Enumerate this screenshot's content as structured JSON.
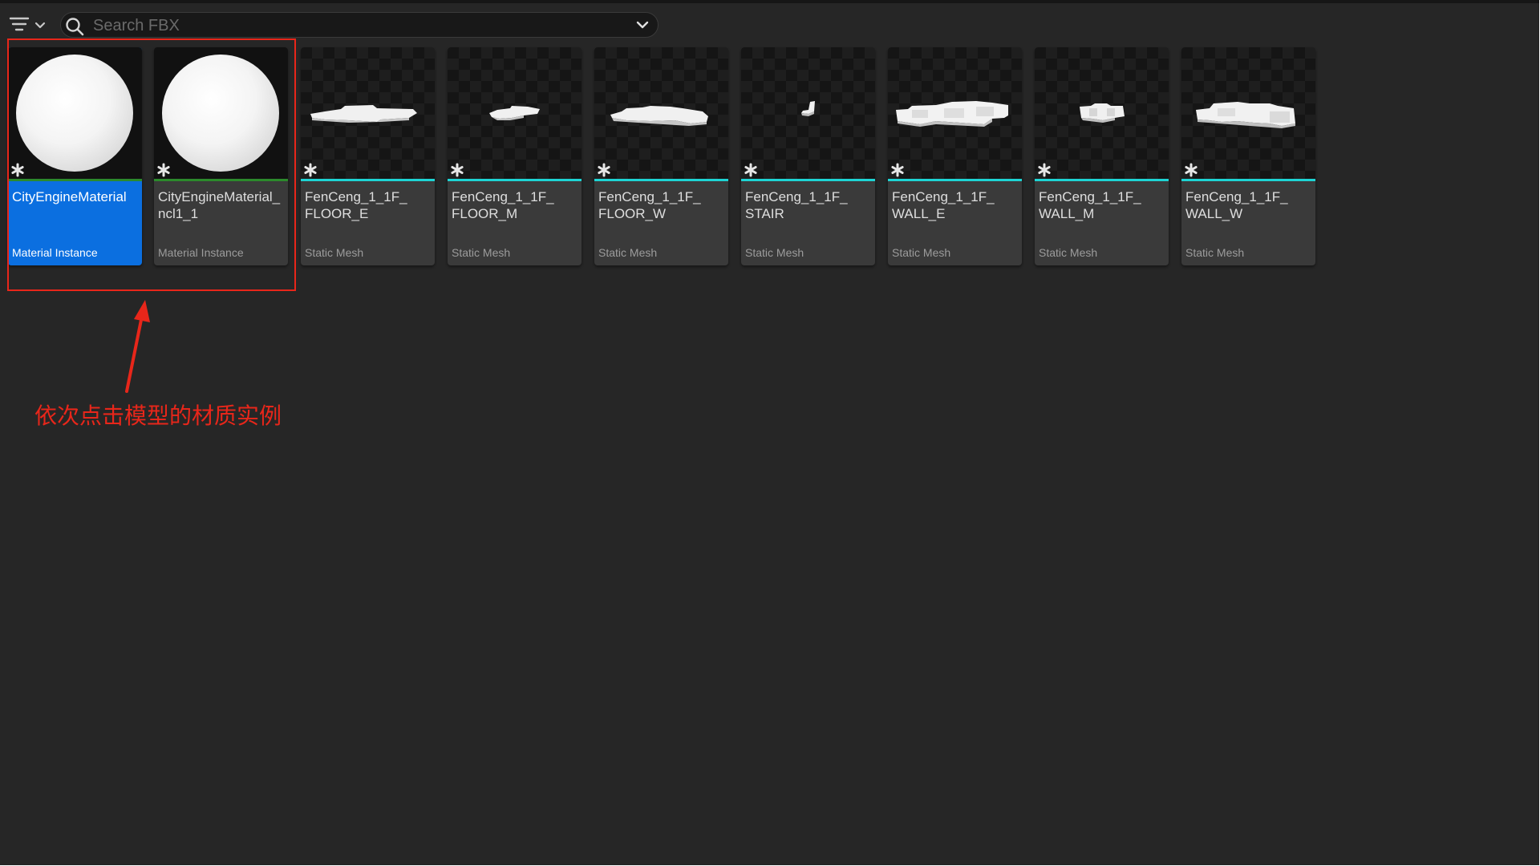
{
  "toolbar": {
    "filter_icon": "filter-lines-icon",
    "search_icon": "search-icon",
    "search_placeholder": "Search FBX",
    "search_value": "",
    "dropdown_icon": "chevron-down-icon"
  },
  "colors": {
    "selected": "#0b6fe0",
    "material_instance_bar": "#2c8a2c",
    "static_mesh_bar": "#1ed4d4",
    "annotation": "#e8261a"
  },
  "assets": [
    {
      "name": "CityEngineMaterial",
      "type": "Material Instance",
      "selected": true
    },
    {
      "name": "CityEngineMaterial_\nncl1_1",
      "type": "Material Instance",
      "selected": false
    },
    {
      "name": "FenCeng_1_1F_\nFLOOR_E",
      "type": "Static Mesh",
      "selected": false
    },
    {
      "name": "FenCeng_1_1F_\nFLOOR_M",
      "type": "Static Mesh",
      "selected": false
    },
    {
      "name": "FenCeng_1_1F_\nFLOOR_W",
      "type": "Static Mesh",
      "selected": false
    },
    {
      "name": "FenCeng_1_1F_\nSTAIR",
      "type": "Static Mesh",
      "selected": false
    },
    {
      "name": "FenCeng_1_1F_\nWALL_E",
      "type": "Static Mesh",
      "selected": false
    },
    {
      "name": "FenCeng_1_1F_\nWALL_M",
      "type": "Static Mesh",
      "selected": false
    },
    {
      "name": "FenCeng_1_1F_\nWALL_W",
      "type": "Static Mesh",
      "selected": false
    }
  ],
  "annotation": {
    "text": "依次点击模型的材质实例"
  }
}
